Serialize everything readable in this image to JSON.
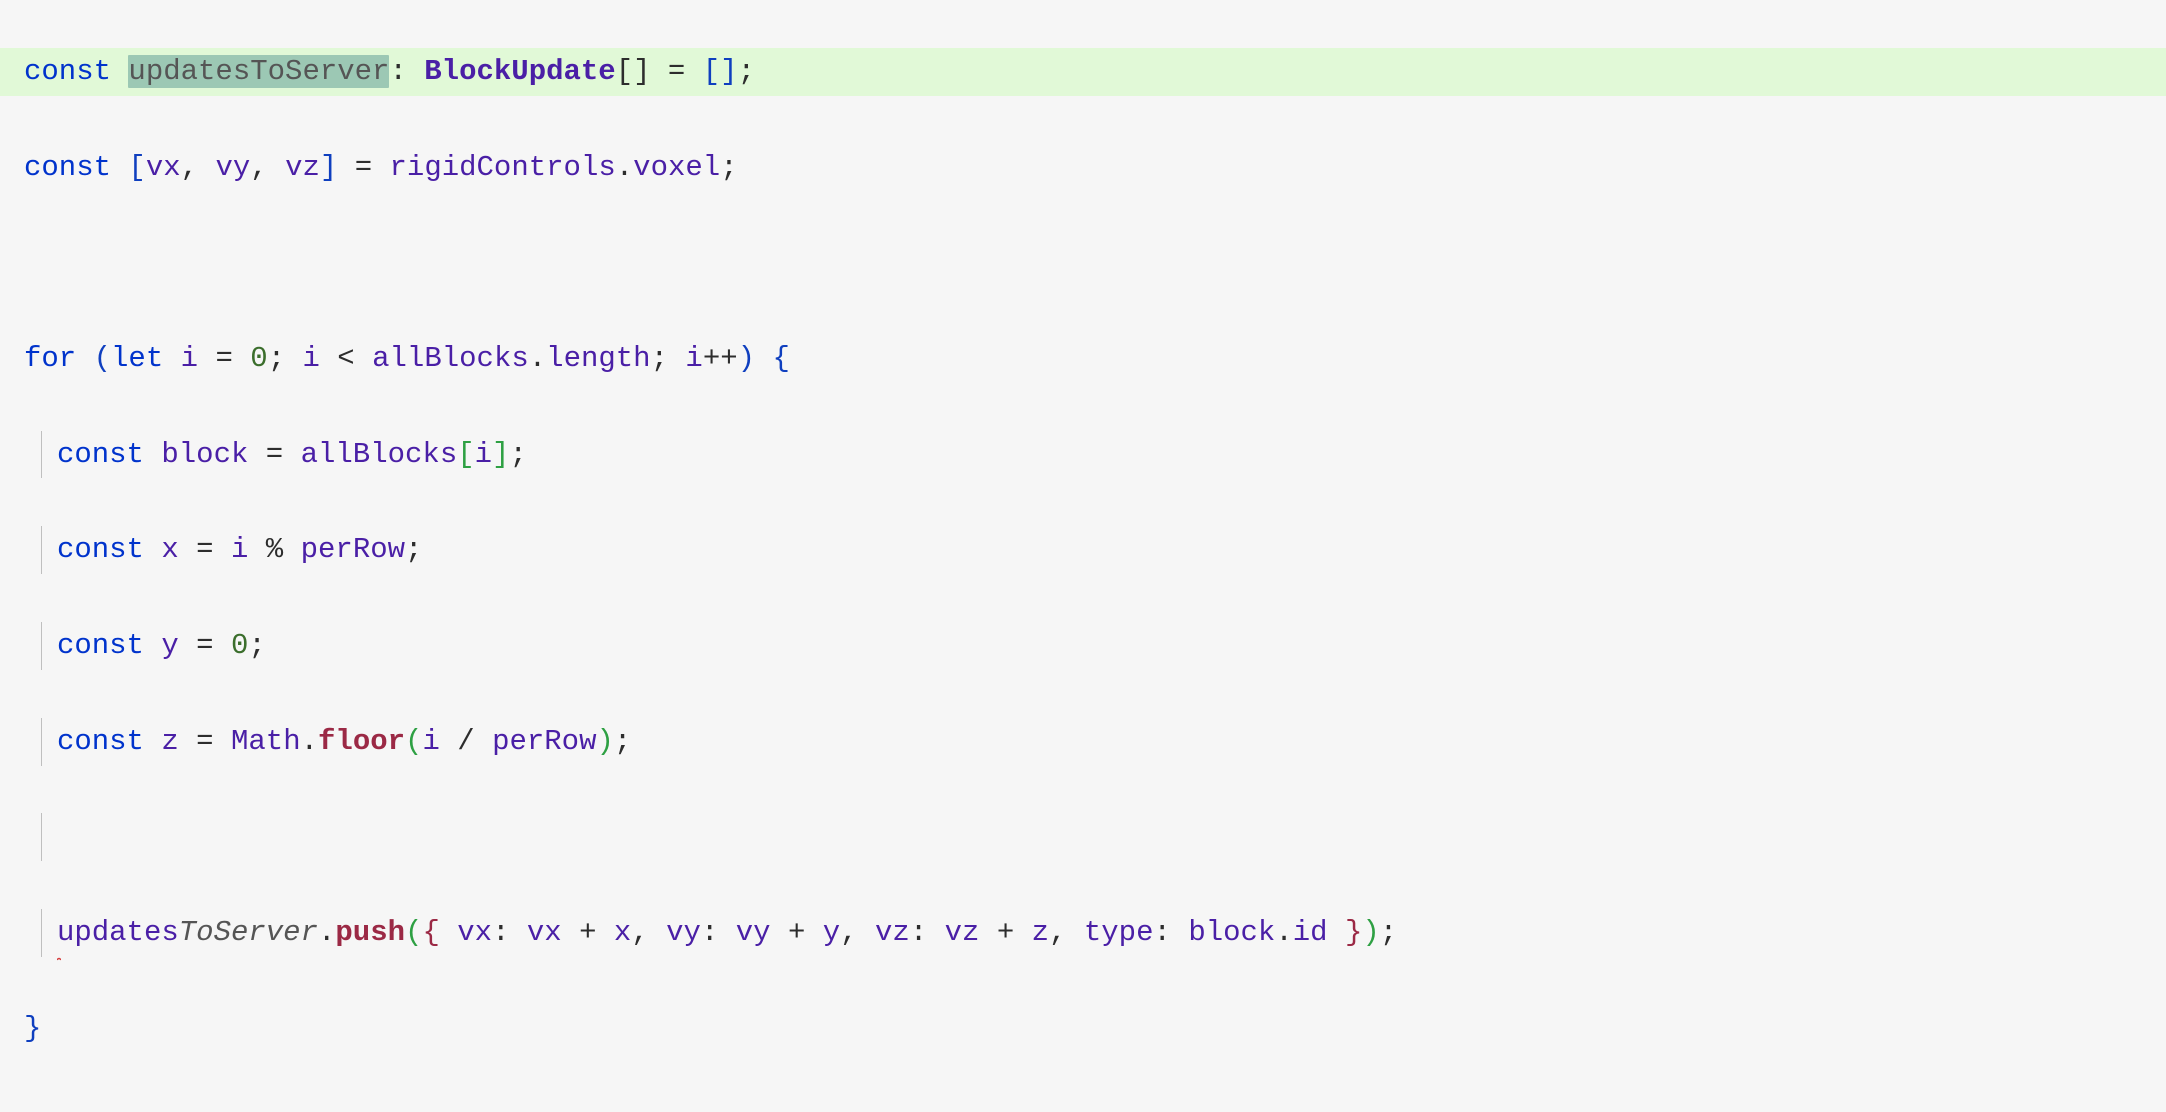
{
  "code": {
    "l1": {
      "const": "const",
      "sel_var": "updatesToServer",
      "colon_sp": ": ",
      "type": "BlockUpdate",
      "brackets": "[]",
      "eq": " = ",
      "empty": "[]",
      "semi": ";"
    },
    "l2": {
      "const": "const",
      "open": " [",
      "vx": "vx",
      "c1": ", ",
      "vy": "vy",
      "c2": ", ",
      "vz": "vz",
      "close": "] = ",
      "obj": "rigidControls",
      "dot": ".",
      "prop": "voxel",
      "semi": ";"
    },
    "l4": {
      "for": "for",
      "open": " (",
      "let": "let",
      "ivar": " i ",
      "eq": "= ",
      "zero": "0",
      "s1": "; ",
      "i2": "i",
      "lt": " < ",
      "arr": "allBlocks",
      "dot": ".",
      "len": "length",
      "s2": "; ",
      "i3": "i",
      "inc": "++",
      "close": ") ",
      "brace": "{"
    },
    "l5": {
      "const": "const",
      "bl": " block ",
      "eq": "= ",
      "arr": "allBlocks",
      "open": "[",
      "i": "i",
      "close": "]",
      "semi": ";"
    },
    "l6": {
      "const": "const",
      "x": " x ",
      "eq": "= ",
      "i": "i",
      "mod": " % ",
      "per": "perRow",
      "semi": ";"
    },
    "l7": {
      "const": "const",
      "y": " y ",
      "eq": "= ",
      "zero": "0",
      "semi": ";"
    },
    "l8": {
      "const": "const",
      "z": " z ",
      "eq": "= ",
      "math": "Math",
      "dot": ".",
      "floor": "floor",
      "open": "(",
      "i": "i",
      "div": " / ",
      "per": "perRow",
      "close": ")",
      "semi": ";"
    },
    "l10": {
      "updates": "updates",
      "toServer": "ToServer",
      "dot": ".",
      "push": "push",
      "popen": "(",
      "bopen": "{ ",
      "k_vx": "vx",
      "c1": ": ",
      "vx": "vx",
      "plus1": " + ",
      "x": "x",
      "cm1": ", ",
      "k_vy": "vy",
      "c2": ": ",
      "vy": "vy",
      "plus2": " + ",
      "y": "y",
      "cm2": ", ",
      "k_vz": "vz",
      "c3": ": ",
      "vz": "vz",
      "plus3": " + ",
      "z": "z",
      "cm3": ", ",
      "k_type": "type",
      "c4": ": ",
      "block": "block",
      "dot2": ".",
      "id": "id",
      "bclose": " }",
      "pclose": ")",
      "semi": ";"
    },
    "l11": {
      "brace": "}"
    }
  }
}
